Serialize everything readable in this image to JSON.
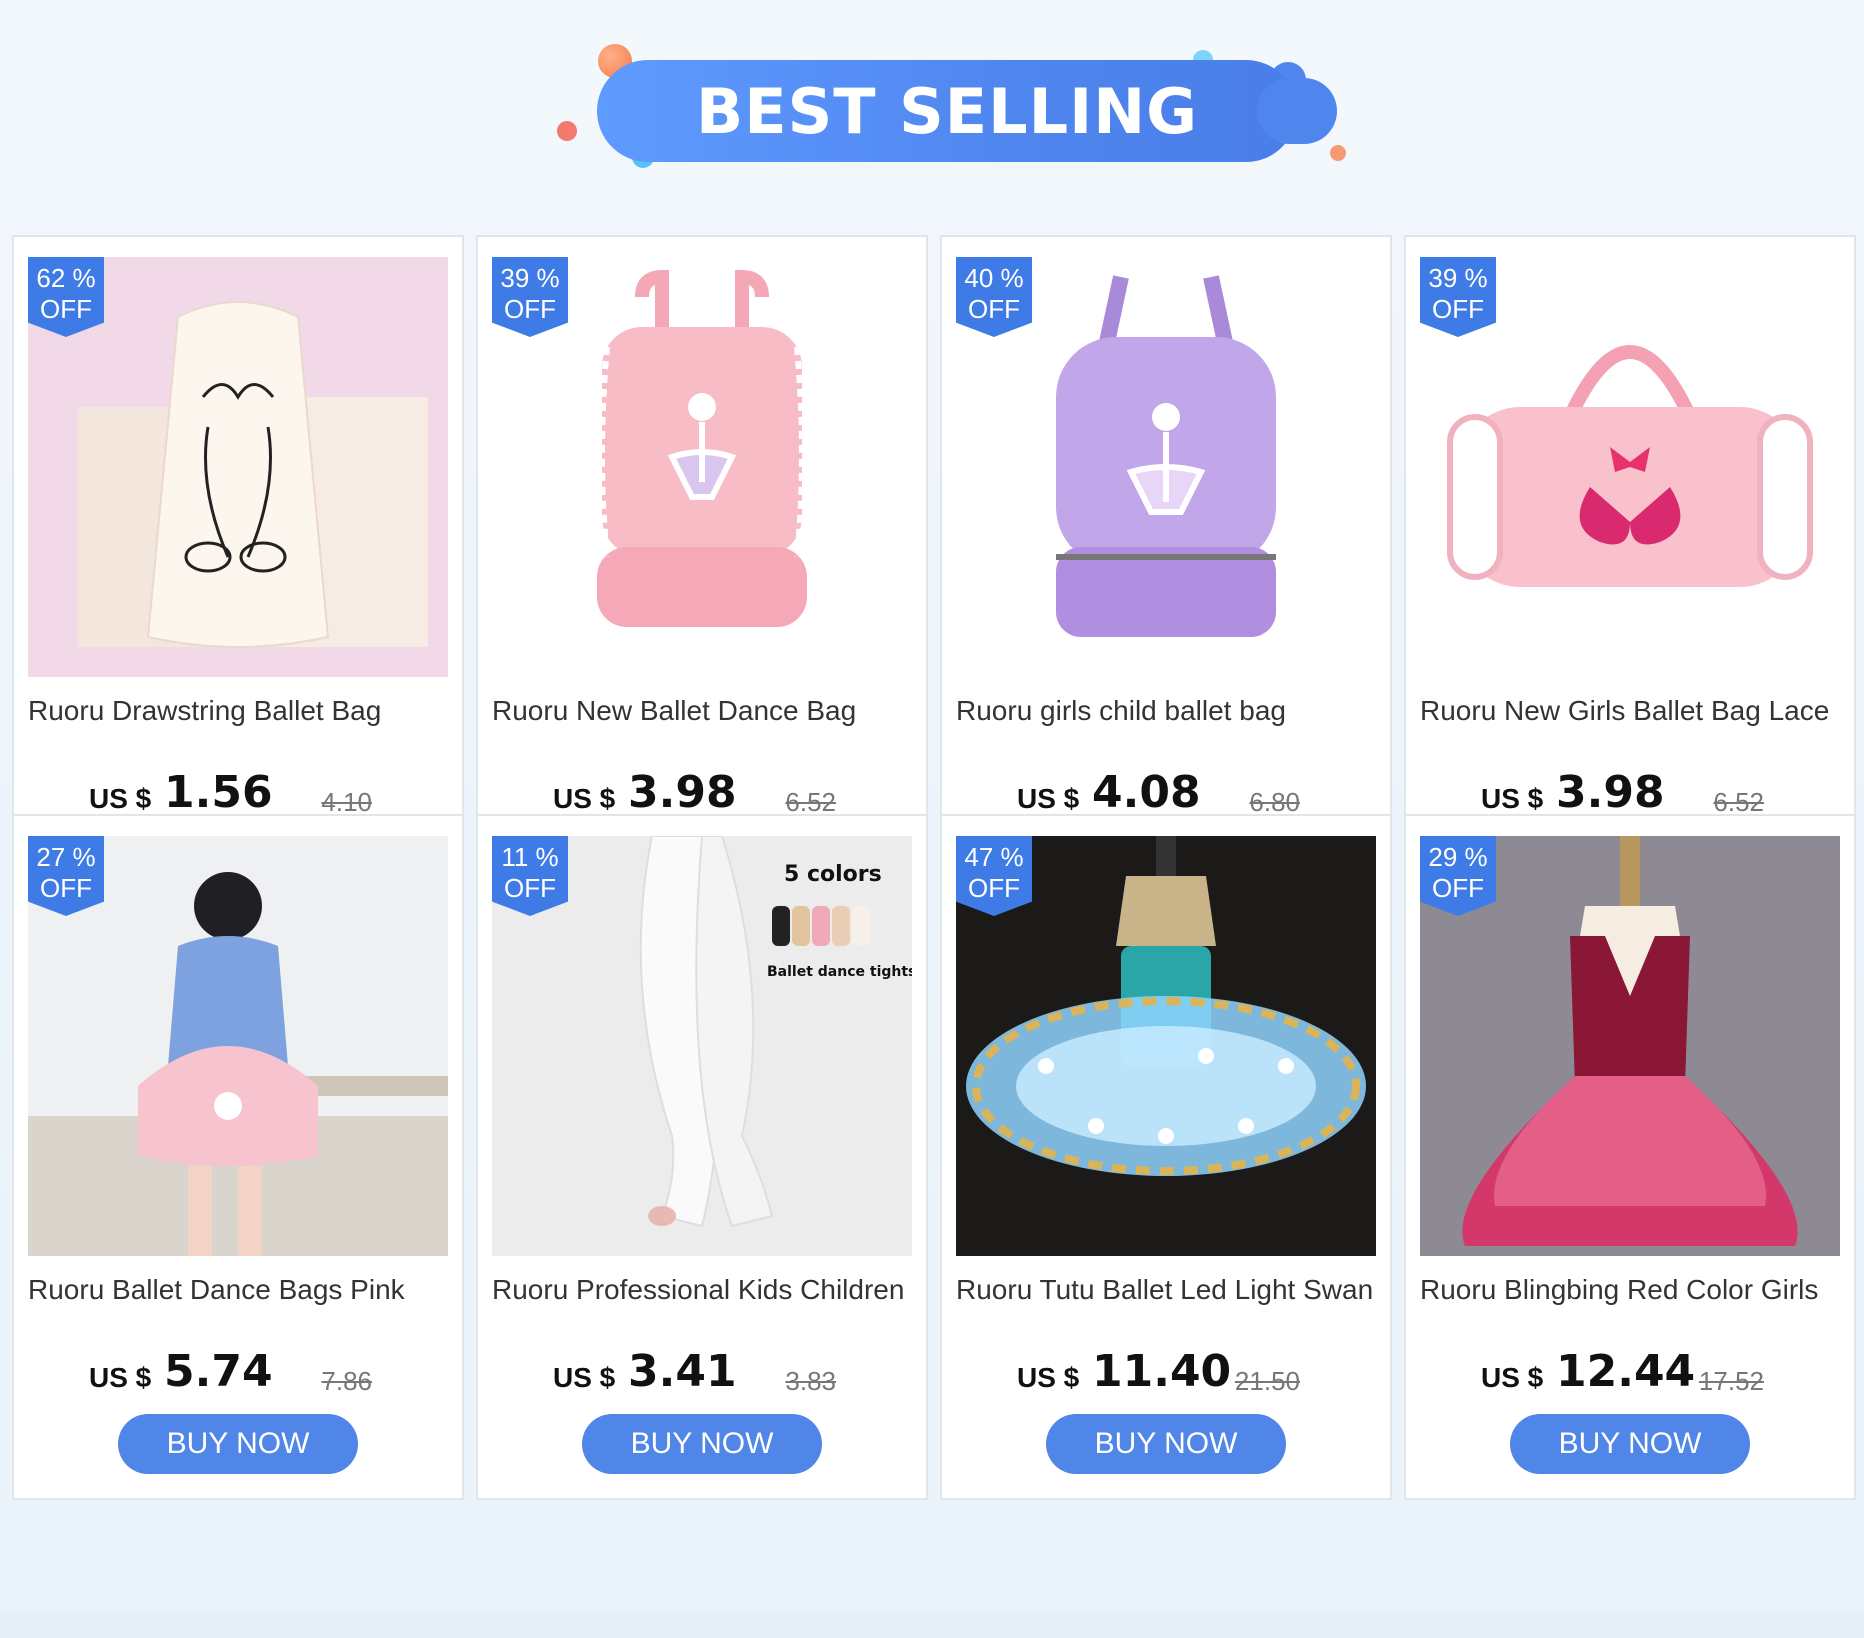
{
  "banner": {
    "title": "BEST SELLING"
  },
  "currency": "US $",
  "buy_label": "BUY NOW",
  "products": [
    {
      "discount_pct": "62 %",
      "discount_off": "OFF",
      "title": "Ruoru Drawstring Ballet Bag",
      "price": "1.56",
      "old_price": "4.10",
      "image": "drawstring-bag-image"
    },
    {
      "discount_pct": "39 %",
      "discount_off": "OFF",
      "title": "Ruoru New Ballet Dance Bag",
      "price": "3.98",
      "old_price": "6.52",
      "image": "pink-backpack-image"
    },
    {
      "discount_pct": "40 %",
      "discount_off": "OFF",
      "title": "Ruoru girls child ballet bag",
      "price": "4.08",
      "old_price": "6.80",
      "image": "purple-backpack-image"
    },
    {
      "discount_pct": "39 %",
      "discount_off": "OFF",
      "title": "Ruoru New Girls Ballet Bag Lace",
      "price": "3.98",
      "old_price": "6.52",
      "image": "duffel-bag-image"
    },
    {
      "discount_pct": "27 %",
      "discount_off": "OFF",
      "title": "Ruoru Ballet Dance Bags Pink",
      "price": "5.74",
      "old_price": "7.86",
      "image": "girl-with-bag-image"
    },
    {
      "discount_pct": "11 %",
      "discount_off": "OFF",
      "title": "Ruoru Professional Kids Children",
      "price": "3.41",
      "old_price": "3.83",
      "image": "tights-image",
      "overlay_line1": "5 colors",
      "overlay_line2": "Ballet dance tights"
    },
    {
      "discount_pct": "47 %",
      "discount_off": "OFF",
      "title": "Ruoru Tutu Ballet Led Light Swan",
      "price": "11.40",
      "old_price": "21.50",
      "image": "led-tutu-image"
    },
    {
      "discount_pct": "29 %",
      "discount_off": "OFF",
      "title": "Ruoru Blingbing Red Color Girls",
      "price": "12.44",
      "old_price": "17.52",
      "image": "red-dress-image"
    }
  ]
}
